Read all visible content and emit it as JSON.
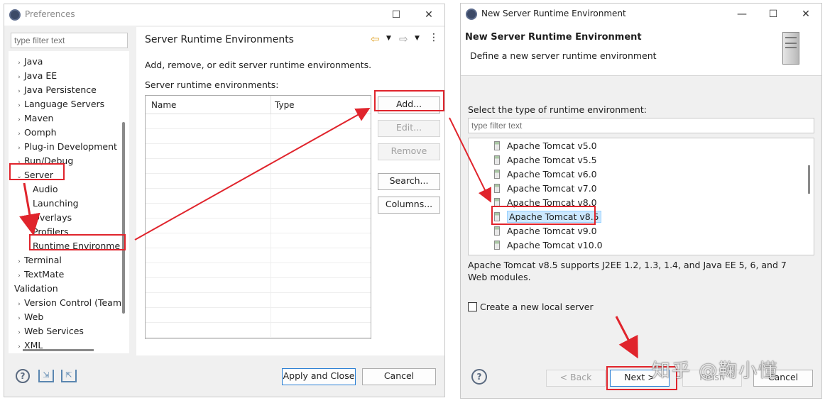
{
  "prefs": {
    "title": "Preferences",
    "filter_placeholder": "type filter text",
    "tree": [
      {
        "label": "Java",
        "arrow": "›"
      },
      {
        "label": "Java EE",
        "arrow": "›"
      },
      {
        "label": "Java Persistence",
        "arrow": "›"
      },
      {
        "label": "Language Servers",
        "arrow": "›"
      },
      {
        "label": "Maven",
        "arrow": "›"
      },
      {
        "label": "Oomph",
        "arrow": "›"
      },
      {
        "label": "Plug-in Development",
        "arrow": "›"
      },
      {
        "label": "Run/Debug",
        "arrow": "›"
      },
      {
        "label": "Server",
        "arrow": "⌄"
      },
      {
        "label": "Audio",
        "arrow": ""
      },
      {
        "label": "Launching",
        "arrow": ""
      },
      {
        "label": "Overlays",
        "arrow": ""
      },
      {
        "label": "Profilers",
        "arrow": ""
      },
      {
        "label": "Runtime Environme",
        "arrow": ""
      },
      {
        "label": "Terminal",
        "arrow": "›"
      },
      {
        "label": "TextMate",
        "arrow": "›"
      },
      {
        "label": "Validation",
        "arrow": ""
      },
      {
        "label": "Version Control (Team",
        "arrow": "›"
      },
      {
        "label": "Web",
        "arrow": "›"
      },
      {
        "label": "Web Services",
        "arrow": "›"
      },
      {
        "label": "XML",
        "arrow": "›"
      }
    ],
    "page_title": "Server Runtime Environments",
    "description": "Add, remove, or edit server runtime environments.",
    "list_label": "Server runtime environments:",
    "columns": [
      "Name",
      "Type"
    ],
    "buttons": {
      "add": "Add...",
      "edit": "Edit...",
      "remove": "Remove",
      "search": "Search...",
      "columns": "Columns..."
    },
    "apply_close": "Apply and Close",
    "cancel": "Cancel"
  },
  "wizard": {
    "title": "New Server Runtime Environment",
    "heading": "New Server Runtime Environment",
    "subheading": "Define a new server runtime environment",
    "select_label": "Select the type of runtime environment:",
    "filter_placeholder": "type filter text",
    "runtimes": [
      "Apache Tomcat v5.0",
      "Apache Tomcat v5.5",
      "Apache Tomcat v6.0",
      "Apache Tomcat v7.0",
      "Apache Tomcat v8.0",
      "Apache Tomcat v8.5",
      "Apache Tomcat v9.0",
      "Apache Tomcat v10.0"
    ],
    "selected_index": 5,
    "description": "Apache Tomcat v8.5 supports J2EE 1.2, 1.3, 1.4, and Java EE 5, 6, and 7 Web modules.",
    "checkbox_label": "Create a new local server",
    "buttons": {
      "back": "< Back",
      "next": "Next >",
      "finish": "Finish",
      "cancel": "Cancel"
    }
  },
  "watermark": "知乎 @鞠小懂",
  "colors": {
    "highlight": "#e0242c",
    "selection": "#cce8ff"
  }
}
